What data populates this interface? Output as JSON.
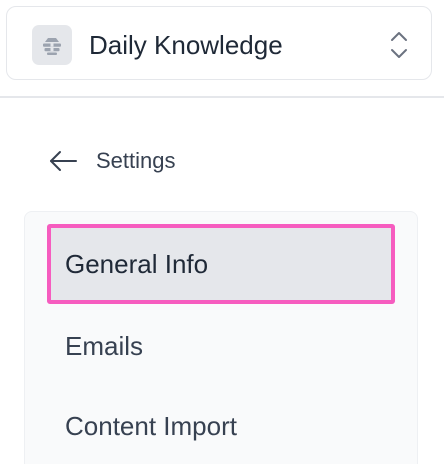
{
  "workspace": {
    "name": "Daily Knowledge",
    "logo_icon": "beehive-icon",
    "switch_icon": "chevron-up-down-icon"
  },
  "back": {
    "icon": "arrow-left-icon",
    "label": "Settings"
  },
  "settings_nav": {
    "items": [
      {
        "label": "General Info",
        "active": true
      },
      {
        "label": "Emails",
        "active": false
      },
      {
        "label": "Content Import",
        "active": false
      }
    ]
  },
  "colors": {
    "highlight_outline": "#f65cbf",
    "active_background": "#e5e7eb",
    "panel_background": "#f9fafb",
    "text_primary": "#1f2937",
    "text_secondary": "#374151"
  }
}
